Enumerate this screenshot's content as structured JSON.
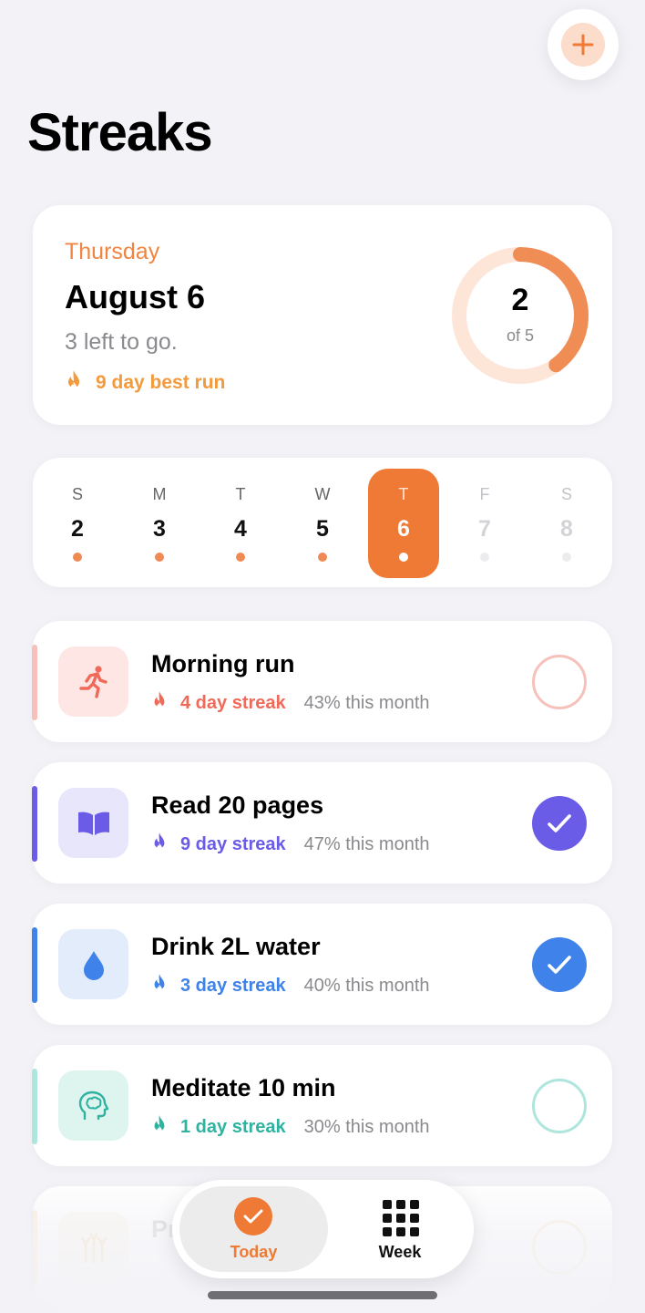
{
  "header": {
    "title": "Streaks",
    "add_icon": "plus-icon"
  },
  "summary": {
    "weekday": "Thursday",
    "date": "August 6",
    "remaining": "3 left to go.",
    "best_run": "9 day best run",
    "progress": {
      "done": "2",
      "of_label": "of 5",
      "fraction": 0.4
    },
    "accent": "#ef7a35"
  },
  "week": {
    "days": [
      {
        "letter": "S",
        "num": "2"
      },
      {
        "letter": "M",
        "num": "3"
      },
      {
        "letter": "T",
        "num": "4"
      },
      {
        "letter": "W",
        "num": "5"
      },
      {
        "letter": "T",
        "num": "6"
      },
      {
        "letter": "F",
        "num": "7"
      },
      {
        "letter": "S",
        "num": "8"
      }
    ],
    "selected_index": 4
  },
  "habits": [
    {
      "name": "Morning run",
      "streak": "4 day streak",
      "month": "43% this month",
      "color": "#f06a5a",
      "completed": false,
      "icon": "running-icon"
    },
    {
      "name": "Read 20 pages",
      "streak": "9 day streak",
      "month": "47% this month",
      "color": "#6b5ce7",
      "completed": true,
      "icon": "book-icon"
    },
    {
      "name": "Drink 2L water",
      "streak": "3 day streak",
      "month": "40% this month",
      "color": "#3e82ea",
      "completed": true,
      "icon": "water-drop-icon"
    },
    {
      "name": "Meditate 10 min",
      "streak": "1 day streak",
      "month": "30% this month",
      "color": "#2fb3a0",
      "completed": false,
      "icon": "brain-icon"
    },
    {
      "name": "Pr",
      "completed": false,
      "icon": "practice-icon",
      "color": "#e8b45a"
    }
  ],
  "tabbar": {
    "today_label": "Today",
    "week_label": "Week"
  }
}
